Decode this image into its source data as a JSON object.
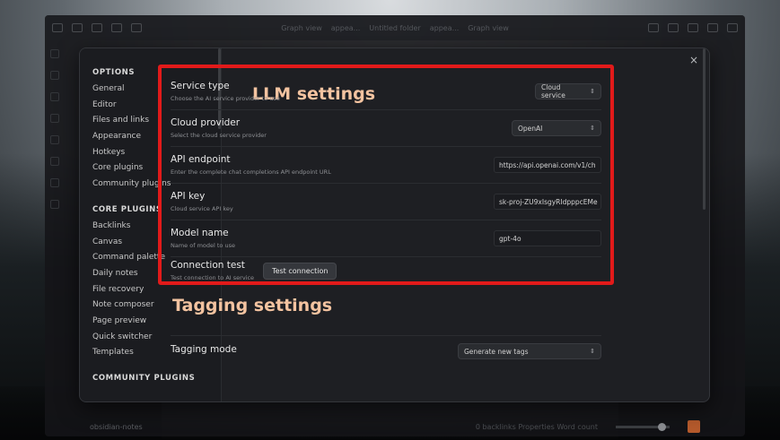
{
  "app": {
    "tabs": [
      "Graph view",
      "appea...",
      "Untitled folder",
      "appea...",
      "Graph view"
    ],
    "vault_name": "obsidian-notes",
    "status_text": "0 backlinks   Properties   Word count"
  },
  "settings": {
    "close_glyph": "×",
    "sidebar": {
      "options_heading": "OPTIONS",
      "options_items": [
        "General",
        "Editor",
        "Files and links",
        "Appearance",
        "Hotkeys",
        "Core plugins",
        "Community plugins"
      ],
      "core_heading": "CORE PLUGINS",
      "core_items": [
        "Backlinks",
        "Canvas",
        "Command palette",
        "Daily notes",
        "File recovery",
        "Note composer",
        "Page preview",
        "Quick switcher",
        "Templates"
      ],
      "community_heading": "COMMUNITY PLUGINS"
    },
    "llm": {
      "title": "LLM settings",
      "service_type": {
        "name": "Service type",
        "desc": "Choose the AI service provider to use",
        "value": "Cloud service"
      },
      "cloud_provider": {
        "name": "Cloud provider",
        "desc": "Select the cloud service provider",
        "value": "OpenAI"
      },
      "api_endpoint": {
        "name": "API endpoint",
        "desc": "Enter the complete chat completions API endpoint URL",
        "value": "https://api.openai.com/v1/ch"
      },
      "api_key": {
        "name": "API key",
        "desc": "Cloud service API key",
        "value": "sk-proj-ZU9xIsgyRIdpppcEMe"
      },
      "model_name": {
        "name": "Model name",
        "desc": "Name of model to use",
        "value": "gpt-4o"
      },
      "connection_test": {
        "name": "Connection test",
        "desc": "Test connection to AI service",
        "button": "Test connection"
      }
    },
    "tagging": {
      "title": "Tagging settings",
      "mode": {
        "name": "Tagging mode",
        "value": "Generate new tags"
      }
    },
    "highlight_color": "#e21a1a",
    "heading_color": "#f3c3a0"
  }
}
